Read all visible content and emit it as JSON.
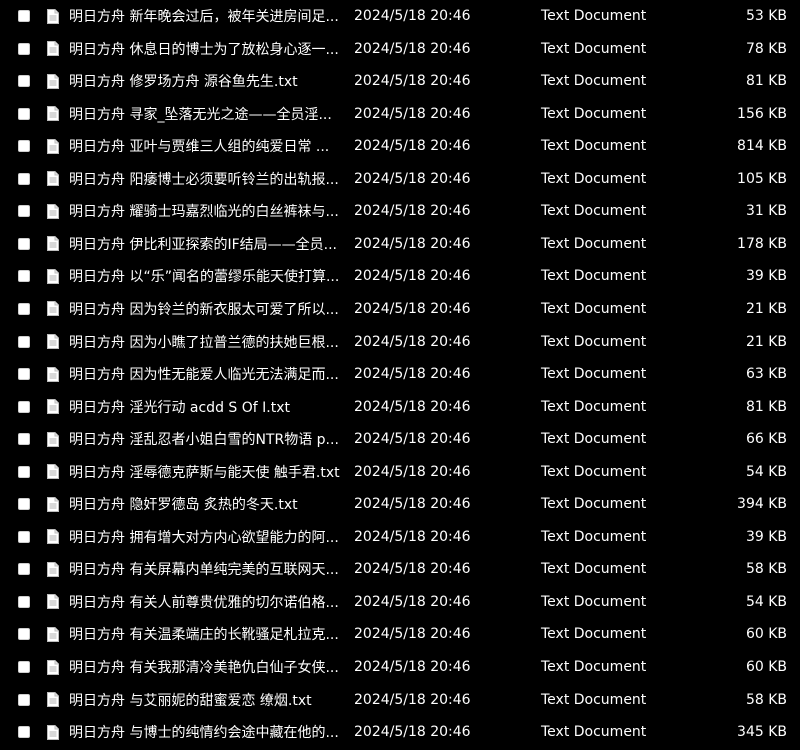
{
  "icon": "text-document-icon",
  "files": [
    {
      "name": "明日方舟 新年晚会过后，被年关进房间足...",
      "date": "2024/5/18 20:46",
      "type": "Text Document",
      "size": "53 KB"
    },
    {
      "name": "明日方舟 休息日的博士为了放松身心逐一...",
      "date": "2024/5/18 20:46",
      "type": "Text Document",
      "size": "78 KB"
    },
    {
      "name": "明日方舟 修罗场方舟 源谷鱼先生.txt",
      "date": "2024/5/18 20:46",
      "type": "Text Document",
      "size": "81 KB"
    },
    {
      "name": "明日方舟 寻家_坠落无光之途——全员淫...",
      "date": "2024/5/18 20:46",
      "type": "Text Document",
      "size": "156 KB"
    },
    {
      "name": "明日方舟 亚叶与贾维三人组的纯爱日常 ...",
      "date": "2024/5/18 20:46",
      "type": "Text Document",
      "size": "814 KB"
    },
    {
      "name": "明日方舟 阳痿博士必须要听铃兰的出轨报...",
      "date": "2024/5/18 20:46",
      "type": "Text Document",
      "size": "105 KB"
    },
    {
      "name": "明日方舟 耀骑士玛嘉烈临光的白丝裤袜与...",
      "date": "2024/5/18 20:46",
      "type": "Text Document",
      "size": "31 KB"
    },
    {
      "name": "明日方舟 伊比利亚探索的IF结局——全员...",
      "date": "2024/5/18 20:46",
      "type": "Text Document",
      "size": "178 KB"
    },
    {
      "name": "明日方舟 以“乐”闻名的蕾缪乐能天使打算...",
      "date": "2024/5/18 20:46",
      "type": "Text Document",
      "size": "39 KB"
    },
    {
      "name": "明日方舟 因为铃兰的新衣服太可爱了所以...",
      "date": "2024/5/18 20:46",
      "type": "Text Document",
      "size": "21 KB"
    },
    {
      "name": "明日方舟 因为小瞧了拉普兰德的扶她巨根...",
      "date": "2024/5/18 20:46",
      "type": "Text Document",
      "size": "21 KB"
    },
    {
      "name": "明日方舟 因为性无能爱人临光无法满足而...",
      "date": "2024/5/18 20:46",
      "type": "Text Document",
      "size": "63 KB"
    },
    {
      "name": "明日方舟 淫光行动 acdd S Of I.txt",
      "date": "2024/5/18 20:46",
      "type": "Text Document",
      "size": "81 KB"
    },
    {
      "name": "明日方舟 淫乱忍者小姐白雪的NTR物语 p...",
      "date": "2024/5/18 20:46",
      "type": "Text Document",
      "size": "66 KB"
    },
    {
      "name": "明日方舟 淫辱德克萨斯与能天使 触手君.txt",
      "date": "2024/5/18 20:46",
      "type": "Text Document",
      "size": "54 KB"
    },
    {
      "name": "明日方舟 隐奸罗德岛 炙热的冬天.txt",
      "date": "2024/5/18 20:46",
      "type": "Text Document",
      "size": "394 KB"
    },
    {
      "name": "明日方舟 拥有增大对方内心欲望能力的阿...",
      "date": "2024/5/18 20:46",
      "type": "Text Document",
      "size": "39 KB"
    },
    {
      "name": "明日方舟 有关屏幕内单纯完美的互联网天...",
      "date": "2024/5/18 20:46",
      "type": "Text Document",
      "size": "58 KB"
    },
    {
      "name": "明日方舟 有关人前尊贵优雅的切尔诺伯格...",
      "date": "2024/5/18 20:46",
      "type": "Text Document",
      "size": "54 KB"
    },
    {
      "name": "明日方舟 有关温柔端庄的长靴骚足札拉克...",
      "date": "2024/5/18 20:46",
      "type": "Text Document",
      "size": "60 KB"
    },
    {
      "name": "明日方舟 有关我那清冷美艳仇白仙子女侠...",
      "date": "2024/5/18 20:46",
      "type": "Text Document",
      "size": "60 KB"
    },
    {
      "name": "明日方舟 与艾丽妮的甜蜜爱恋 缭烟.txt",
      "date": "2024/5/18 20:46",
      "type": "Text Document",
      "size": "58 KB"
    },
    {
      "name": "明日方舟 与博士的纯情约会途中藏在他的...",
      "date": "2024/5/18 20:46",
      "type": "Text Document",
      "size": "345 KB"
    }
  ]
}
